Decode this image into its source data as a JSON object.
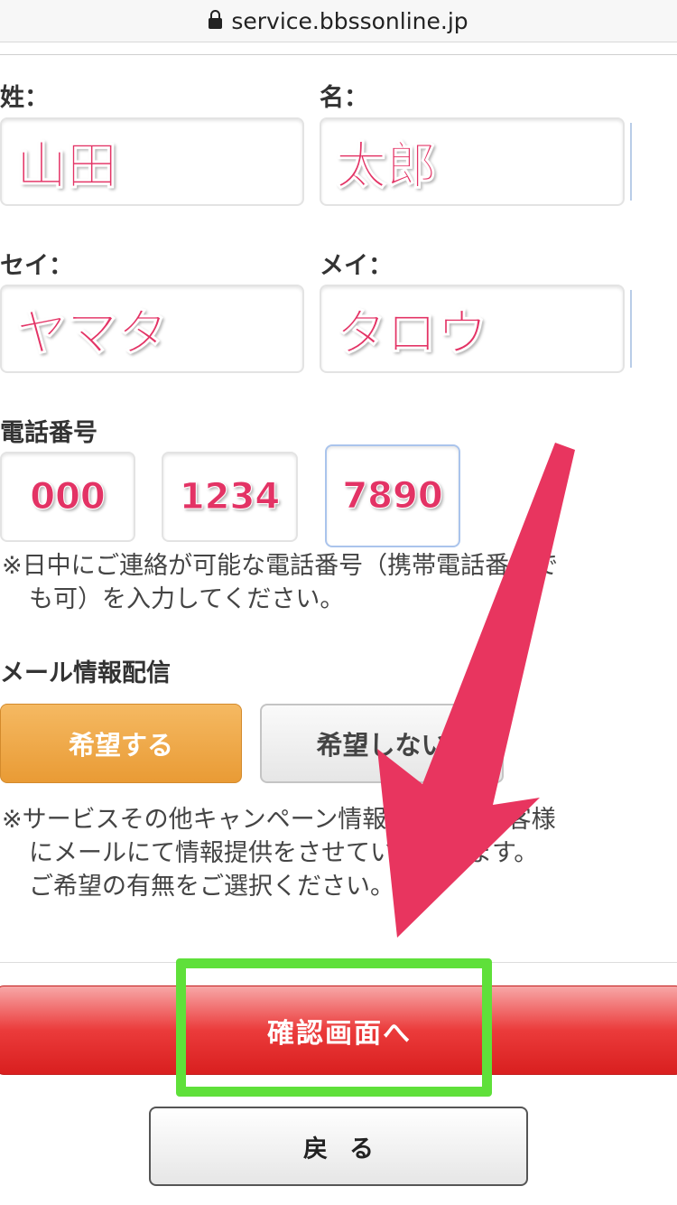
{
  "browser": {
    "url": "service.bbssonline.jp"
  },
  "form": {
    "last_name": {
      "label": "姓：",
      "value": "山田"
    },
    "first_name": {
      "label": "名：",
      "value": "太郎"
    },
    "last_name_kana": {
      "label": "セイ：",
      "value": "ヤマタ"
    },
    "first_name_kana": {
      "label": "メイ：",
      "value": "タロウ"
    },
    "phone": {
      "label": "電話番号",
      "part1": "000",
      "part2": "1234",
      "part3": "7890",
      "note_line1": "※日中にご連絡が可能な電話番号（携帯電話番号で",
      "note_line2": "も可）を入力してください。"
    },
    "mail": {
      "label": "メール情報配信",
      "hope_label": "希望する",
      "no_hope_label": "希望しない",
      "note_line1": "※サービスその他キャンペーン情報についてお客様",
      "note_line2": "にメールにて情報提供をさせていただきます。",
      "note_line3": "ご希望の有無をご選択ください。"
    }
  },
  "actions": {
    "confirm_label": "確認画面へ",
    "back_label": "戻る"
  },
  "annotation": {
    "arrow_color": "#e8355f",
    "highlight_color": "#5fe03a"
  }
}
